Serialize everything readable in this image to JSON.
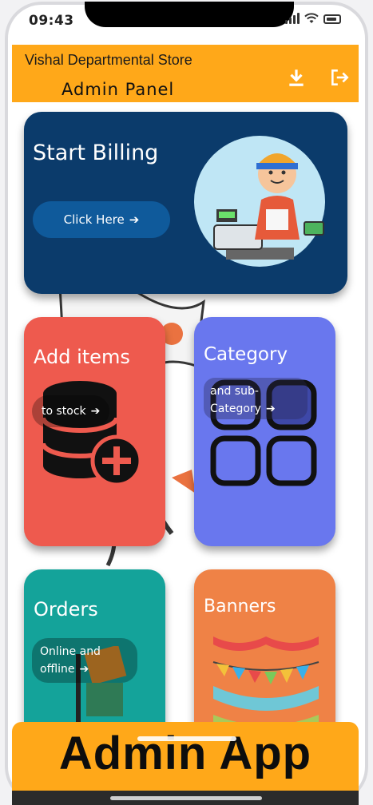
{
  "status_bar": {
    "time": "09:43"
  },
  "app_bar": {
    "store_name": "Vishal Departmental Store",
    "title": "Admin Panel",
    "download_icon": "download-icon",
    "logout_icon": "logout-icon"
  },
  "cards": {
    "billing": {
      "title": "Start Billing",
      "button_label": "Click Here"
    },
    "add_items": {
      "title": "Add items",
      "subtitle": "to stock"
    },
    "category": {
      "title": "Category",
      "subtitle_line1": "and sub-",
      "subtitle_line2": "Category"
    },
    "orders": {
      "title": "Orders",
      "subtitle_line1": "Online and",
      "subtitle_line2": "offline"
    },
    "banners": {
      "title": "Banners"
    }
  },
  "bottom_banner": {
    "text": "Admin App"
  },
  "colors": {
    "accent": "#ffa819",
    "billing": "#0b3b6b",
    "add_items": "#ee5a4e",
    "category": "#6977ee",
    "orders": "#14a39a",
    "banners": "#ef8246"
  }
}
